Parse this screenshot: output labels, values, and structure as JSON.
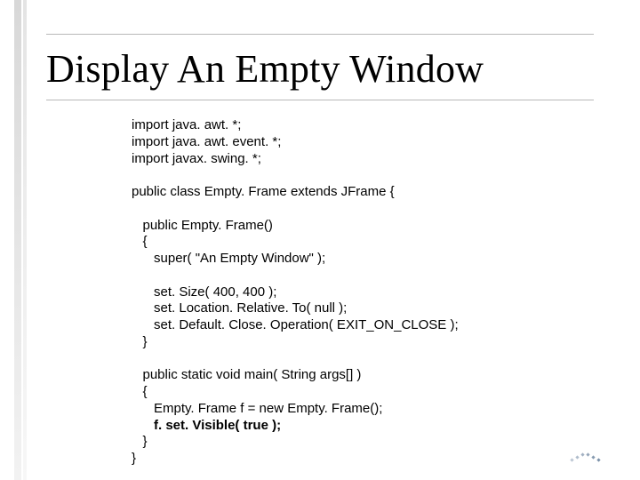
{
  "title": "Display An Empty Window",
  "code": {
    "l1": "import java. awt. *;",
    "l2": "import java. awt. event. *;",
    "l3": "import javax. swing. *;",
    "l4": "",
    "l5": "public class Empty. Frame extends JFrame {",
    "l6": "",
    "l7": "   public Empty. Frame()",
    "l8": "   {",
    "l9": "      super( \"An Empty Window\" );",
    "l10": "",
    "l11": "      set. Size( 400, 400 );",
    "l12": "      set. Location. Relative. To( null );",
    "l13": "      set. Default. Close. Operation( EXIT_ON_CLOSE );",
    "l14": "   }",
    "l15": "",
    "l16": "   public static void main( String args[] )",
    "l17": "   {",
    "l18": "      Empty. Frame f = new Empty. Frame();",
    "l19": "      f. set. Visible( true );",
    "l20": "   }",
    "l21": "}"
  }
}
